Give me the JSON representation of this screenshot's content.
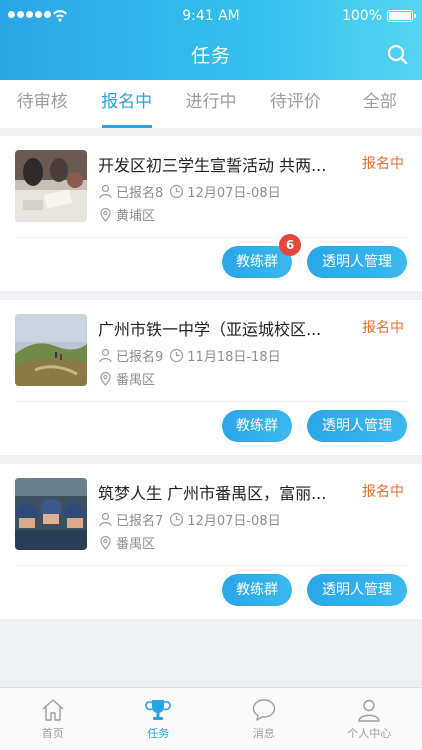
{
  "status_bar": {
    "time": "9:41 AM",
    "battery": "100%"
  },
  "header": {
    "title": "任务"
  },
  "tabs": [
    {
      "label": "待审核"
    },
    {
      "label": "报名中"
    },
    {
      "label": "进行中"
    },
    {
      "label": "待评价"
    },
    {
      "label": "全部"
    }
  ],
  "active_tab": "报名中",
  "cards": [
    {
      "title": "开发区初三学生宣誓活动 共两...",
      "status": "报名中",
      "signed": "已报名8",
      "date": "12月07日-08日",
      "district": "黄埔区",
      "coach_label": "教练群",
      "manage_label": "透明人管理",
      "badge": "6"
    },
    {
      "title": "广州市铁一中学（亚运城校区...",
      "status": "报名中",
      "signed": "已报名9",
      "date": "11月18日-18日",
      "district": "番禺区",
      "coach_label": "教练群",
      "manage_label": "透明人管理"
    },
    {
      "title": "筑梦人生 广州市番禺区，富丽...",
      "status": "报名中",
      "signed": "已报名7",
      "date": "12月07日-08日",
      "district": "番禺区",
      "coach_label": "教练群",
      "manage_label": "透明人管理"
    }
  ],
  "tab_bar": [
    {
      "label": "首页",
      "icon": "home-icon"
    },
    {
      "label": "任务",
      "icon": "trophy-icon"
    },
    {
      "label": "消息",
      "icon": "chat-icon"
    },
    {
      "label": "个人中心",
      "icon": "person-icon"
    }
  ],
  "colors": {
    "accent": "#2aa2e3",
    "status": "#f06b2a",
    "badge": "#e8463d"
  }
}
